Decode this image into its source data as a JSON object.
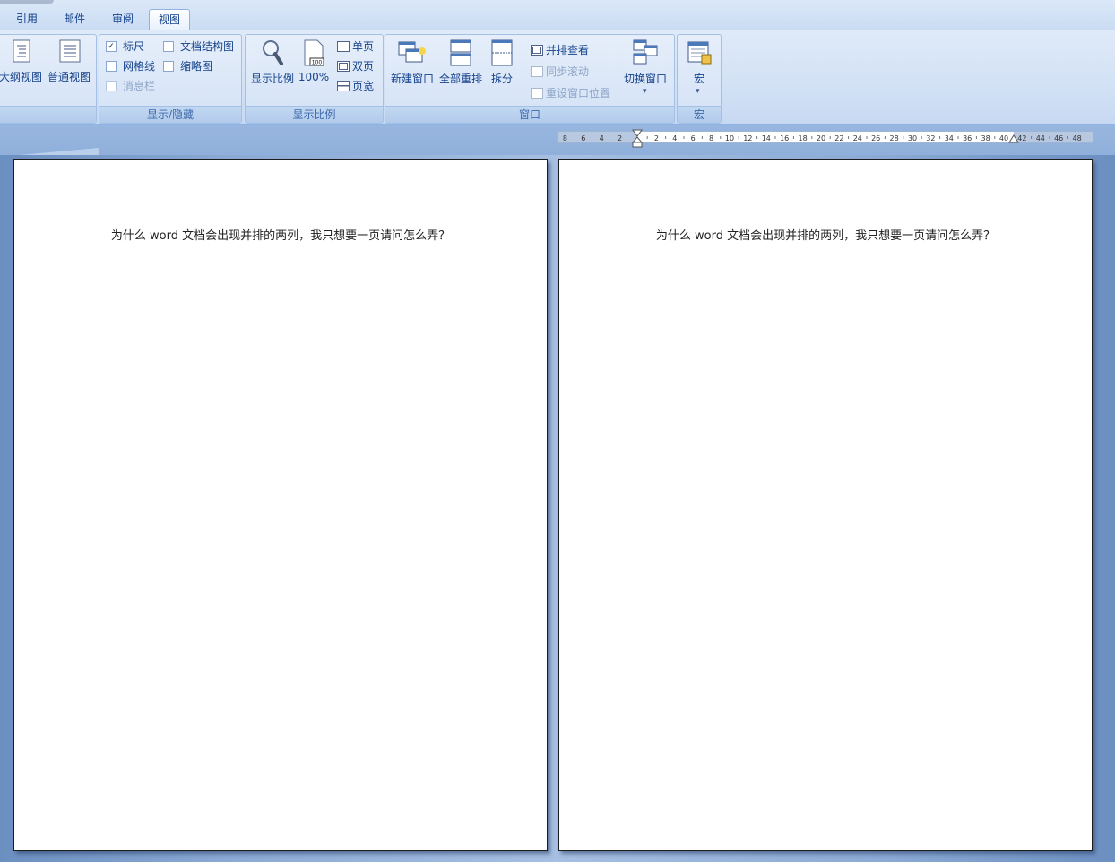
{
  "tabs": [
    {
      "label": "引用",
      "active": false
    },
    {
      "label": "邮件",
      "active": false
    },
    {
      "label": "审阅",
      "active": false
    },
    {
      "label": "视图",
      "active": true
    }
  ],
  "ribbon": {
    "views": {
      "outline_label": "大纲视图",
      "draft_label": "普通视图"
    },
    "show_hide": {
      "group_label": "显示/隐藏",
      "ruler_label": "标尺",
      "ruler_checked": true,
      "gridlines_label": "网格线",
      "message_bar_label": "消息栏",
      "doc_map_label": "文档结构图",
      "thumbnails_label": "缩略图"
    },
    "zoom": {
      "group_label": "显示比例",
      "zoom_label": "显示比例",
      "hundred_label": "100%",
      "hundred_icon_text": "100",
      "one_page_label": "单页",
      "two_pages_label": "双页",
      "page_width_label": "页宽"
    },
    "window": {
      "group_label": "窗口",
      "new_window_label": "新建窗口",
      "arrange_all_label": "全部重排",
      "split_label": "拆分",
      "side_by_side_label": "并排查看",
      "sync_scroll_label": "同步滚动",
      "reset_position_label": "重设窗口位置",
      "switch_windows_label": "切换窗口"
    },
    "macros": {
      "group_label": "宏",
      "macros_label": "宏"
    }
  },
  "ruler": {
    "left_labels": [
      "8",
      "6",
      "4",
      "2"
    ],
    "right_labels": [
      "2",
      "4",
      "6",
      "8",
      "10",
      "12",
      "14",
      "16",
      "18",
      "20",
      "22",
      "24",
      "26",
      "28",
      "30",
      "32",
      "34",
      "36",
      "38",
      "40",
      "42",
      "44",
      "46",
      "48"
    ]
  },
  "pages": [
    {
      "text": "为什么 word 文档会出现并排的两列，我只想要一页请问怎么弄？"
    },
    {
      "text": "为什么 word 文档会出现并排的两列，我只想要一页请问怎么弄？"
    }
  ]
}
